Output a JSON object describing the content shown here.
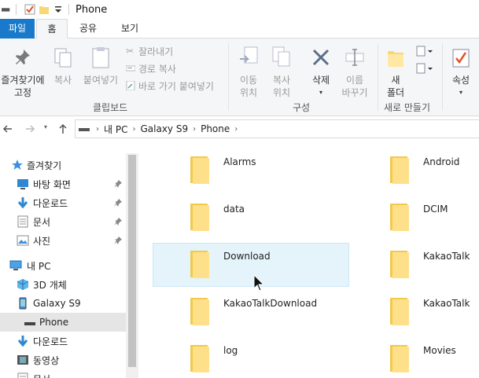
{
  "window": {
    "title": "Phone"
  },
  "ribbon": {
    "tabs": [
      "파일",
      "홈",
      "공유",
      "보기"
    ],
    "clipboard": {
      "pin_label_1": "즐겨찾기에",
      "pin_label_2": "고정",
      "copy": "복사",
      "paste": "붙여넣기",
      "cut": "잘라내기",
      "copy_path": "경로 복사",
      "paste_shortcut": "바로 가기 붙여넣기",
      "group": "클립보드"
    },
    "organize": {
      "move_1": "이동",
      "move_2": "위치",
      "copy_1": "복사",
      "copy_2": "위치",
      "delete": "삭제",
      "rename_1": "이름",
      "rename_2": "바꾸기",
      "group": "구성"
    },
    "new": {
      "new_folder_1": "새",
      "new_folder_2": "폴더",
      "group": "새로 만들기"
    },
    "open": {
      "properties": "속성"
    }
  },
  "address": {
    "crumbs": [
      "내 PC",
      "Galaxy S9",
      "Phone"
    ]
  },
  "sidebar": {
    "items": [
      {
        "label": "즐겨찾기",
        "icon": "star-icon"
      },
      {
        "label": "바탕 화면",
        "icon": "desktop-icon",
        "pinned": true
      },
      {
        "label": "다운로드",
        "icon": "download-arrow-icon",
        "pinned": true
      },
      {
        "label": "문서",
        "icon": "document-icon",
        "pinned": true
      },
      {
        "label": "사진",
        "icon": "picture-icon",
        "pinned": true
      },
      {
        "label": "내 PC",
        "icon": "computer-icon"
      },
      {
        "label": "3D 개체",
        "icon": "cube-3d-icon"
      },
      {
        "label": "Galaxy S9",
        "icon": "phone-device-icon"
      },
      {
        "label": "Phone",
        "icon": "drive-icon",
        "selected": true
      },
      {
        "label": "다운로드",
        "icon": "download-arrow-icon"
      },
      {
        "label": "동영상",
        "icon": "video-icon"
      },
      {
        "label": "문서",
        "icon": "document-icon"
      }
    ]
  },
  "files": [
    {
      "name": "Alarms"
    },
    {
      "name": "Android"
    },
    {
      "name": "data"
    },
    {
      "name": "DCIM"
    },
    {
      "name": "Download",
      "hover": true
    },
    {
      "name": "KakaoTalk"
    },
    {
      "name": "KakaoTalkDownload"
    },
    {
      "name": "KakaoTalk"
    },
    {
      "name": "log"
    },
    {
      "name": "Movies"
    }
  ],
  "colors": {
    "accent": "#1979ca",
    "folder": "#f8d775",
    "hover_bg": "#e5f3fb"
  }
}
